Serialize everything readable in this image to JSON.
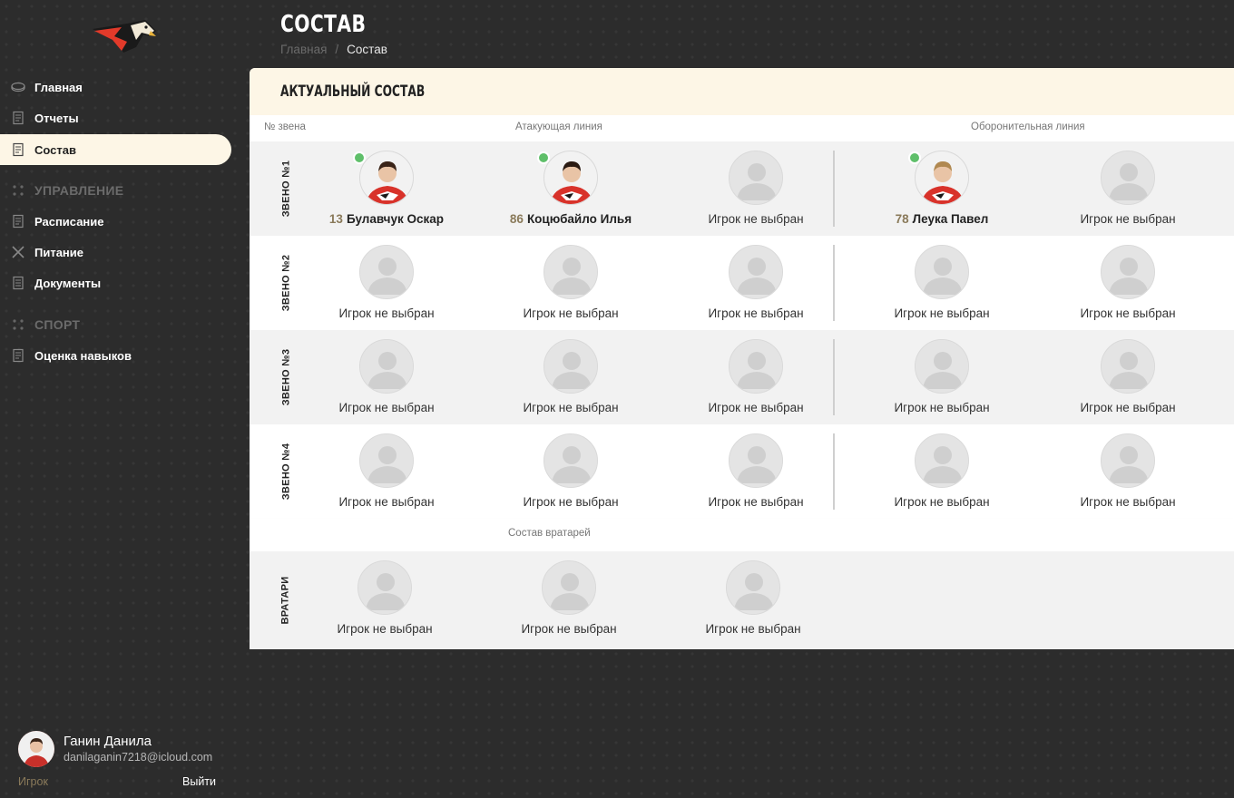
{
  "sidebar": {
    "nav": [
      {
        "label": "Главная",
        "icon": "puck-icon"
      },
      {
        "label": "Отчеты",
        "icon": "report-icon"
      },
      {
        "label": "Состав",
        "icon": "roster-icon",
        "active": true
      }
    ],
    "section_management": "УПРАВЛЕНИЕ",
    "management_items": [
      {
        "label": "Расписание",
        "icon": "schedule-icon"
      },
      {
        "label": "Питание",
        "icon": "food-icon"
      },
      {
        "label": "Документы",
        "icon": "documents-icon"
      }
    ],
    "section_sport": "СПОРТ",
    "sport_items": [
      {
        "label": "Оценка навыков",
        "icon": "skills-icon"
      }
    ],
    "user": {
      "name": "Ганин Данила",
      "email": "danilaganin7218@icloud.com",
      "role": "Игрок",
      "logout": "Выйти"
    }
  },
  "header": {
    "title": "СОСТАВ",
    "breadcrumb_home": "Главная",
    "breadcrumb_sep": "/",
    "breadcrumb_current": "Состав"
  },
  "panel": {
    "title": "АКТУАЛЬНЫЙ СОСТАВ",
    "col_line_number": "№ звена",
    "col_attack": "Атакующая линия",
    "col_defense": "Оборонительная линия",
    "goalies_header": "Состав вратарей",
    "goalies_label": "ВРАТАРИ",
    "empty_label": "Игрок не выбран",
    "lines": [
      {
        "label": "ЗВЕНО №1",
        "players": [
          {
            "number": "13",
            "name": "Булавчук Оскар",
            "online": true
          },
          {
            "number": "86",
            "name": "Коцюбайло Илья",
            "online": true
          },
          null,
          {
            "number": "78",
            "name": "Леука Павел",
            "online": true
          },
          null
        ]
      },
      {
        "label": "ЗВЕНО №2",
        "players": [
          null,
          null,
          null,
          null,
          null
        ]
      },
      {
        "label": "ЗВЕНО №3",
        "players": [
          null,
          null,
          null,
          null,
          null
        ]
      },
      {
        "label": "ЗВЕНО №4",
        "players": [
          null,
          null,
          null,
          null,
          null
        ]
      }
    ],
    "goalies": [
      null,
      null,
      null
    ]
  },
  "colors": {
    "accent_cream": "#fdf6e6",
    "online": "#5fbf6a",
    "number_gold": "#8a7a5a"
  }
}
